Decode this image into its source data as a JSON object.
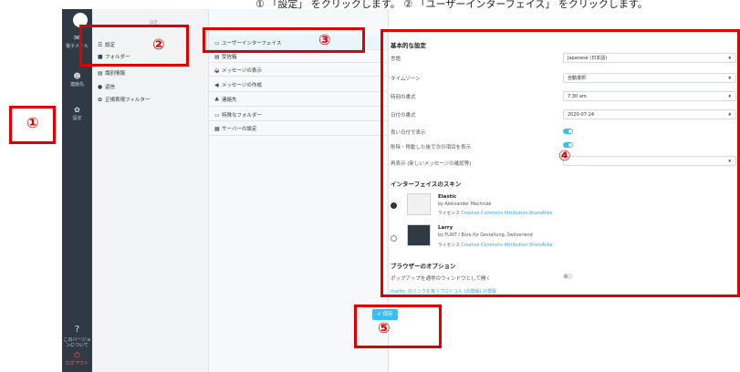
{
  "top_fragment": "① 「設定」 をクリックします。 ② 「ユーザーインターフェイス」 をクリックします。",
  "nav": {
    "items": [
      {
        "icon": "mail-icon",
        "label": "電子メール"
      },
      {
        "icon": "contacts-icon",
        "label": "連絡先"
      },
      {
        "icon": "gear-icon",
        "label": "設定"
      }
    ],
    "help_label": "このバージョンについて",
    "logout_label": "ログアウト"
  },
  "folders": {
    "items": [
      {
        "icon": "☰",
        "label": "設定"
      },
      {
        "icon": "■",
        "label": "フォルダー"
      },
      {
        "icon": "▤",
        "label": "識別情報"
      },
      {
        "icon": "●",
        "label": "返信"
      },
      {
        "icon": "✿",
        "label": "正規表現フィルター"
      }
    ],
    "header": "設定"
  },
  "sections": {
    "items": [
      {
        "icon": "▭",
        "label": "ユーザーインターフェイス"
      },
      {
        "icon": "▤",
        "label": "受信箱"
      },
      {
        "icon": "◒",
        "label": "メッセージの表示"
      },
      {
        "icon": "◀",
        "label": "メッセージの作成"
      },
      {
        "icon": "♣",
        "label": "連絡先"
      },
      {
        "icon": "▭",
        "label": "特殊なフォルダー"
      },
      {
        "icon": "▦",
        "label": "サーバーの設定"
      }
    ]
  },
  "main": {
    "basic_heading": "基本的な設定",
    "rows": [
      {
        "label": "言語",
        "value": "Japanese (日本語)"
      },
      {
        "label": "タイムゾーン",
        "value": "自動選択"
      },
      {
        "label": "時刻の書式",
        "value": "7:30 am"
      },
      {
        "label": "日付の書式",
        "value": "2020-07-24"
      }
    ],
    "toggle_rows": [
      {
        "label": "良い日付で表示",
        "on": true
      },
      {
        "label": "削除・移動した後で次の項目を表示",
        "on": true
      }
    ],
    "refresh_label": "再表示 (新しいメッセージの確認等)",
    "refresh_value": "",
    "skins_heading": "インターフェイスのスキン",
    "skins": [
      {
        "name": "Elastic",
        "author": "by Aleksander Machniak",
        "license_prefix": "ライセンス",
        "license": "Creative Commons Attribution-ShareAlike",
        "selected": true
      },
      {
        "name": "Larry",
        "author": "by FLINT / Büro für Gestaltung, Switzerland",
        "license_prefix": "ライセンス",
        "license": "Creative Commons Attribution-ShareAlike",
        "selected": false
      }
    ],
    "browser_heading": "ブラウザーのオプション",
    "popup_label": "ポップアップを通常のウィンドウとして開く",
    "popup_on": false,
    "mailto_link": "mailto: のリンクを扱うプロトコル (の登録) の登録",
    "save_label": "保存"
  },
  "callouts": [
    "①",
    "②",
    "③",
    "④",
    "⑤"
  ],
  "colors": {
    "accent": "#37beff",
    "callout": "#e00000",
    "nav_bg": "#2f3a44"
  }
}
